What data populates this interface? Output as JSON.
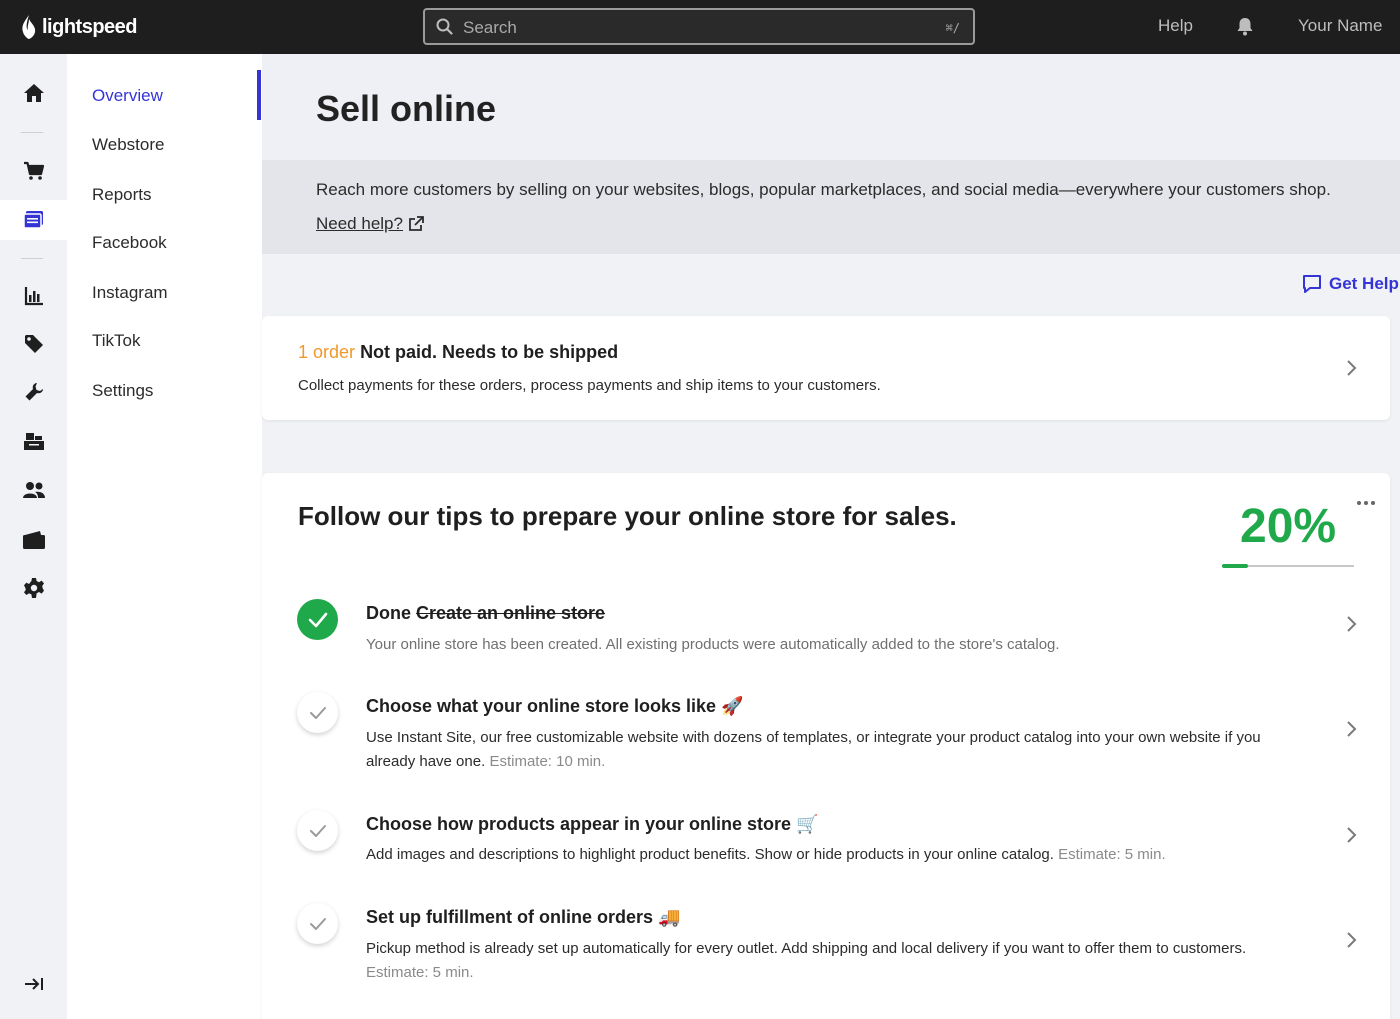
{
  "topbar": {
    "brand": "lightspeed",
    "search_placeholder": "Search",
    "search_shortcut": "⌘/",
    "help": "Help",
    "user": "Your Name"
  },
  "rail": {
    "icons": [
      "home-icon",
      "cart-icon",
      "online-store-icon",
      "reports-icon",
      "tag-icon",
      "wrench-icon",
      "inventory-icon",
      "customers-icon",
      "wallet-icon",
      "settings-icon"
    ],
    "active": "online-store-icon",
    "expand_icon": "collapse-arrow-icon"
  },
  "subnav": {
    "items": [
      "Overview",
      "Webstore",
      "Reports",
      "Facebook",
      "Instagram",
      "TikTok",
      "Settings"
    ],
    "active": "Overview"
  },
  "page": {
    "title": "Sell online",
    "banner_text": "Reach more customers by selling on your websites, blogs, popular marketplaces, and social media—everywhere your customers shop.",
    "banner_link": "Need help?",
    "get_help": "Get Help"
  },
  "order_card": {
    "count": "1 order",
    "title": "Not paid. Needs to be shipped",
    "description": "Collect payments for these orders, process payments and ship items to your customers."
  },
  "tips": {
    "title": "Follow our tips to prepare your online store for sales.",
    "progress_text": "20%",
    "progress_value": 0.2,
    "steps": [
      {
        "status": "done",
        "done_label": "Done",
        "title": "Create an online store",
        "description": "Your online store has been created. All existing products were automatically added to the store's catalog.",
        "estimate": ""
      },
      {
        "status": "todo",
        "title": "Choose what your online store looks like 🚀",
        "description": "Use Instant Site, our free customizable website with dozens of templates, or integrate your product catalog into your own website if you already have one.",
        "estimate": "Estimate: 10 min."
      },
      {
        "status": "todo",
        "title": "Choose how products appear in your online store 🛒",
        "description": "Add images and descriptions to highlight product benefits. Show or hide products in your online catalog.",
        "estimate": "Estimate: 5 min."
      },
      {
        "status": "todo",
        "title": "Set up fulfillment of online orders 🚚",
        "description": "Pickup method is already set up automatically for every outlet. Add shipping and local delivery if you want to offer them to customers.",
        "estimate": "Estimate: 5 min."
      }
    ]
  },
  "colors": {
    "accent": "#3535d6",
    "success": "#1fa94b",
    "warning": "#f0982a",
    "topbar": "#1e1e1e"
  }
}
